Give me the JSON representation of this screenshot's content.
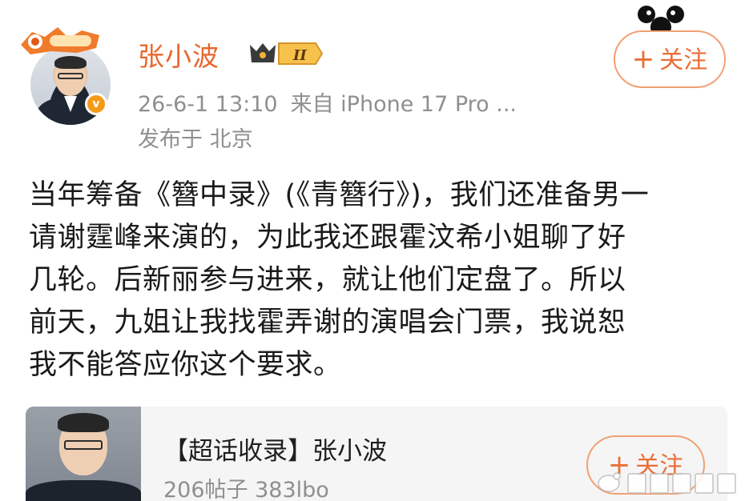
{
  "post": {
    "author": {
      "name": "张小波",
      "level_badge": "II",
      "verified_mark": "v"
    },
    "meta": {
      "time": "26-6-1 13:10",
      "source": "来自 iPhone 17 Pro ...",
      "location": "发布于 北京"
    },
    "follow": {
      "plus": "+",
      "label": "关注"
    },
    "text_lines": [
      "当年筹备《簪中录》(《青簪行》)，我们还准备男一",
      "请谢霆峰来演的，为此我还跟霍汶希小姐聊了好",
      "几轮。后新丽参与进来，就让他们定盘了。所以",
      "前天，九姐让我找霍弄谢的演唱会门票，我说恕",
      "我不能答应你这个要求。"
    ]
  },
  "topic_card": {
    "title": "【超话收录】张小波",
    "stats": "206帖子 383lbo",
    "follow": {
      "plus": "+",
      "label": "关注"
    }
  },
  "colors": {
    "accent": "#ea6e37",
    "username": "#e9662c",
    "meta": "#8f8f8f",
    "card_bg": "#f5f5f5"
  }
}
